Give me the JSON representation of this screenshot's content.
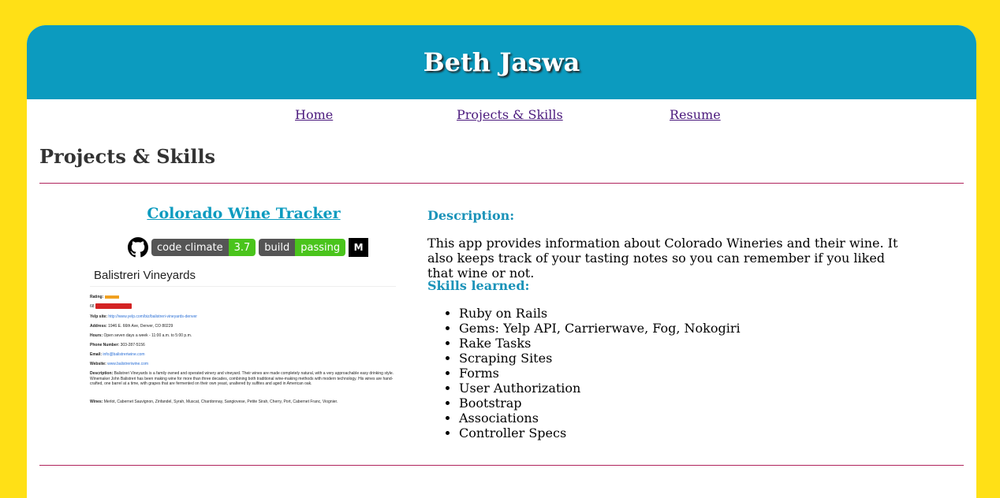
{
  "header": {
    "title": "Beth Jaswa"
  },
  "nav": {
    "items": [
      "Home",
      "Projects & Skills",
      "Resume"
    ]
  },
  "page": {
    "title": "Projects & Skills"
  },
  "project": {
    "title": "Colorado Wine Tracker",
    "badges": {
      "code_climate_label": "code climate",
      "code_climate_value": "3.7",
      "build_label": "build",
      "build_value": "passing",
      "m_badge": "M"
    },
    "screenshot": {
      "title": "Balistreri Vineyards",
      "rating_label": "Rating:",
      "count": "68",
      "yelp_label": "Yelp site:",
      "yelp_url": "http://www.yelp.com/biz/balistreri-vineyards-denver",
      "address_label": "Address:",
      "address": "1946 E. 66th Ave, Denver, CO 80229",
      "hours_label": "Hours:",
      "hours": "Open seven days a week - 11:00 a.m. to 5:00 p.m.",
      "phone_label": "Phone Number:",
      "phone": "303-287-5156",
      "email_label": "Email:",
      "email": "info@balistreriwine.com",
      "website_label": "Website:",
      "website": "www.balistreriwine.com",
      "description_label": "Description:",
      "description": "Balistreri Vineyards is a family owned and operated winery and vineyard. Their wines are made completely natural, with a very approachable easy drinking style. Winemaker John Balistreri has been making wine for more than three decades, combining both traditional wine-making methods with modern technology. His wines are hand-crafted, one barrel at a time, with grapes that are fermented on their own yeast, unaltered by sulfites and aged in American oak.",
      "wines_label": "Wines:",
      "wines": "Merlot, Cabernet Sauvignon, Zinfandel, Syrah, Muscat, Chardonnay, Sangiovese, Petite Sirah, Cherry, Port, Cabernet Franc, Viognier."
    },
    "description_heading": "Description:",
    "description": "This app provides information about Colorado Wineries and their wine. It also keeps track of your tasting notes so you can remember if you liked that wine or not.",
    "skills_heading": "Skills learned:",
    "skills": [
      "Ruby on Rails",
      "Gems: Yelp API, Carrierwave, Fog, Nokogiri",
      "Rake Tasks",
      "Scraping Sites",
      "Forms",
      "User Authorization",
      "Bootstrap",
      "Associations",
      "Controller Specs"
    ]
  },
  "colors": {
    "background": "#ffe016",
    "header": "#0c9bbf",
    "accent": "#1b93b9",
    "rule": "#b0245c",
    "link": "#4b1a7d"
  },
  "icons": {
    "github": "github-icon"
  }
}
